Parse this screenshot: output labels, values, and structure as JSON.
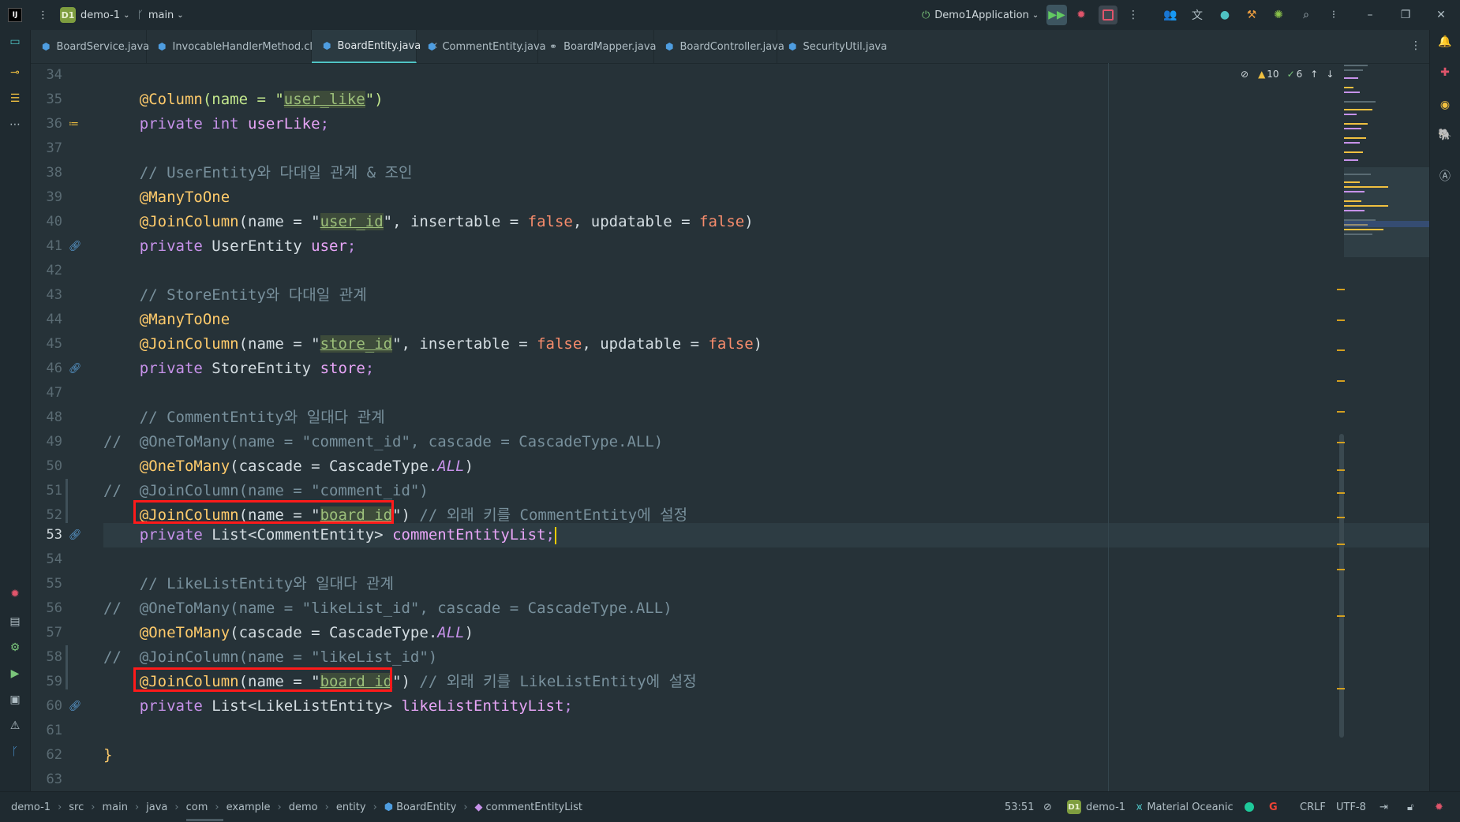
{
  "toolbar": {
    "project_badge": "D1",
    "project_name": "demo-1",
    "branch": "main",
    "run_config": "Demo1Application"
  },
  "tabs": [
    {
      "label": "BoardService.java",
      "icon": "class-icon"
    },
    {
      "label": "InvocableHandlerMethod.class",
      "icon": "class-icon"
    },
    {
      "label": "BoardEntity.java",
      "icon": "class-icon",
      "active": true
    },
    {
      "label": "CommentEntity.java",
      "icon": "class-icon"
    },
    {
      "label": "BoardMapper.java",
      "icon": "interface-icon"
    },
    {
      "label": "BoardController.java",
      "icon": "class-icon"
    },
    {
      "label": "SecurityUtil.java",
      "icon": "class-icon"
    }
  ],
  "inspection": {
    "warnings": "10",
    "typos": "6"
  },
  "editor": {
    "current_line": "53",
    "lines": [
      {
        "n": "34"
      },
      {
        "n": "35"
      },
      {
        "n": "36"
      },
      {
        "n": "37"
      },
      {
        "n": "38"
      },
      {
        "n": "39"
      },
      {
        "n": "40"
      },
      {
        "n": "41"
      },
      {
        "n": "42"
      },
      {
        "n": "43"
      },
      {
        "n": "44"
      },
      {
        "n": "45"
      },
      {
        "n": "46"
      },
      {
        "n": "47"
      },
      {
        "n": "48"
      },
      {
        "n": "49"
      },
      {
        "n": "50"
      },
      {
        "n": "51"
      },
      {
        "n": "52"
      },
      {
        "n": "53"
      },
      {
        "n": "54"
      },
      {
        "n": "55"
      },
      {
        "n": "56"
      },
      {
        "n": "57"
      },
      {
        "n": "58"
      },
      {
        "n": "59"
      },
      {
        "n": "60"
      },
      {
        "n": "61"
      },
      {
        "n": "62"
      },
      {
        "n": "63"
      }
    ],
    "code": {
      "l35_ann": "@Column",
      "l35_pre": "(name = \"",
      "l35_str": "user_like",
      "l35_post": "\")",
      "l36_kw": "private int ",
      "l36_fld": "userLike",
      "l36_end": ";",
      "l38": "// UserEntity와 다대일 관계 & 조인",
      "l39": "@ManyToOne",
      "l40_ann": "@JoinColumn",
      "l40_pre": "(name = \"",
      "l40_str": "user_id",
      "l40_mid1": "\", insertable = ",
      "l40_false1": "false",
      "l40_mid2": ", updatable = ",
      "l40_false2": "false",
      "l40_end": ")",
      "l41_kw": "private ",
      "l41_ty": "UserEntity ",
      "l41_fld": "user",
      "l41_end": ";",
      "l43": "// StoreEntity와 다대일 관계",
      "l44": "@ManyToOne",
      "l45_ann": "@JoinColumn",
      "l45_pre": "(name = \"",
      "l45_str": "store_id",
      "l45_mid1": "\", insertable = ",
      "l45_false1": "false",
      "l45_mid2": ", updatable = ",
      "l45_false2": "false",
      "l45_end": ")",
      "l46_kw": "private ",
      "l46_ty": "StoreEntity ",
      "l46_fld": "store",
      "l46_end": ";",
      "l48": "// CommentEntity와 일대다 관계",
      "l49": "//  @OneToMany(name = \"comment_id\", cascade = CascadeType.ALL)",
      "l50_ann": "@OneToMany",
      "l50_pre": "(cascade = CascadeType.",
      "l50_it": "ALL",
      "l50_end": ")",
      "l51": "//  @JoinColumn(name = \"comment_id\")",
      "l52_ann": "@JoinColumn",
      "l52_pre": "(name = \"",
      "l52_str": "board_id",
      "l52_post": "\")",
      "l52_cm": " // 외래 키를 CommentEntity에 설정",
      "l53_kw": "private ",
      "l53_ty": "List<CommentEntity> ",
      "l53_fld": "commentEntityList",
      "l53_end": ";",
      "l55": "// LikeListEntity와 일대다 관계",
      "l56": "//  @OneToMany(name = \"likeList_id\", cascade = CascadeType.ALL)",
      "l57_ann": "@OneToMany",
      "l57_pre": "(cascade = CascadeType.",
      "l57_it": "ALL",
      "l57_end": ")",
      "l58": "//  @JoinColumn(name = \"likeList_id\")",
      "l59_ann": "@JoinColumn",
      "l59_pre": "(name = \"",
      "l59_str": "board_id",
      "l59_post": "\")",
      "l59_cm": " // 외래 키를 LikeListEntity에 설정",
      "l60_kw": "private ",
      "l60_ty": "List<LikeListEntity> ",
      "l60_fld": "likeListEntityList",
      "l60_end": ";",
      "l62": "}"
    }
  },
  "breadcrumb": [
    "demo-1",
    "src",
    "main",
    "java",
    "com",
    "example",
    "demo",
    "entity",
    "BoardEntity",
    "commentEntityList"
  ],
  "status": {
    "position": "53:51",
    "module_badge": "D1",
    "module": "demo-1",
    "theme": "Material Oceanic",
    "line_ending": "CRLF",
    "encoding": "UTF-8"
  }
}
